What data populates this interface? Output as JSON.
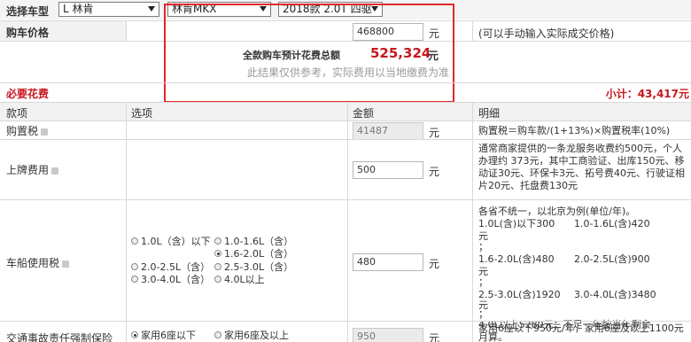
{
  "top": {
    "label": "选择车型",
    "brand": "L 林肯",
    "model": "林肯MKX",
    "trim": "2018款 2.0T 四驱"
  },
  "price": {
    "label": "购车价格",
    "value": "468800",
    "unit": "元",
    "hint": "(可以手动输入实际成交价格)",
    "total_label": "全款购车预计花费总额",
    "total_value": "525,324",
    "total_unit": "元",
    "disclaimer": "此结果仅供参考，实际费用以当地缴费为准"
  },
  "section": {
    "title": "必要花费",
    "subtotal": "小计：43,417元"
  },
  "columns": [
    "款项",
    "选项",
    "金额",
    "明细"
  ],
  "rows": {
    "purchase_tax": {
      "label": "购置税",
      "value": "41487",
      "unit": "元",
      "detail": "购置税＝购车款/(1+13%)×购置税率(10%)"
    },
    "plate_fee": {
      "label": "上牌费用",
      "value": "500",
      "unit": "元",
      "detail": "通常商家提供的一条龙服务收费约500元，个人办理约 373元，其中工商验证、出库150元、移动证30元、环保卡3元、拓号费40元、行驶证相片20元、托盘费130元"
    },
    "vehicle_tax": {
      "label": "车船使用税",
      "value": "480",
      "unit": "元",
      "options": [
        "1.0L（含）以下",
        "1.0-1.6L（含）",
        "2.0-2.5L（含）",
        "1.6-2.0L（含）",
        "2.5-3.0L（含）",
        "3.0-4.0L（含）",
        "4.0L以上"
      ],
      "detail_lines": [
        "各省不统一，以北京为例(单位/年)。",
        "1.0L(含)以下300",
        "1.0-1.6L(含)420",
        "元",
        "；",
        "1.6-2.0L(含)480",
        "2.0-2.5L(含)900",
        "元",
        "；",
        "2.5-3.0L(含)1920",
        "3.0-4.0L(含)3480",
        "元",
        "；",
        "4.0L以上5280元；不足一年按当年剩余",
        "月算。"
      ]
    },
    "insurance": {
      "label": "交通事故责任强制保险",
      "value": "950",
      "unit": "元",
      "options": [
        "家用6座以下",
        "家用6座及以上"
      ],
      "detail": "家用6座以下950元/年，家用6座及以上1100元"
    }
  },
  "colors": {
    "red": "#c7161e",
    "highlight": "#e2262e"
  }
}
